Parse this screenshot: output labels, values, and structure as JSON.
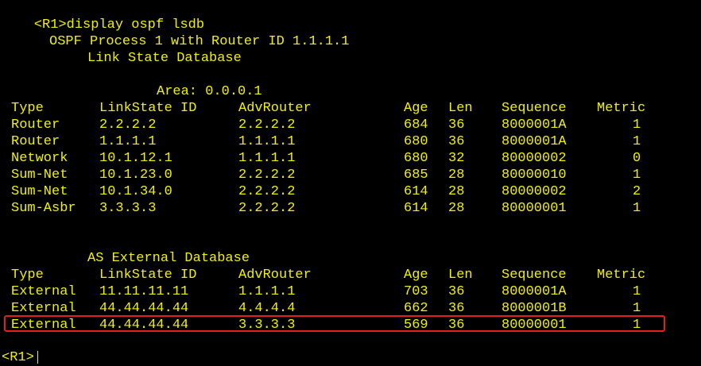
{
  "command_line": {
    "prompt": "<R1>",
    "command": "display ospf lsdb"
  },
  "header": {
    "process_line": "OSPF Process 1 with Router ID 1.1.1.1",
    "database_title": "Link State Database"
  },
  "area_section": {
    "area_label": "Area: 0.0.0.1",
    "columns": [
      "Type",
      "LinkState ID",
      "AdvRouter",
      "Age",
      "Len",
      "Sequence",
      "Metric"
    ],
    "rows": [
      {
        "type": "Router",
        "link_state_id": "2.2.2.2",
        "adv_router": "2.2.2.2",
        "age": "684",
        "len": "36",
        "sequence": "8000001A",
        "metric": "1"
      },
      {
        "type": "Router",
        "link_state_id": "1.1.1.1",
        "adv_router": "1.1.1.1",
        "age": "680",
        "len": "36",
        "sequence": "8000001A",
        "metric": "1"
      },
      {
        "type": "Network",
        "link_state_id": "10.1.12.1",
        "adv_router": "1.1.1.1",
        "age": "680",
        "len": "32",
        "sequence": "80000002",
        "metric": "0"
      },
      {
        "type": "Sum-Net",
        "link_state_id": "10.1.23.0",
        "adv_router": "2.2.2.2",
        "age": "685",
        "len": "28",
        "sequence": "80000010",
        "metric": "1"
      },
      {
        "type": "Sum-Net",
        "link_state_id": "10.1.34.0",
        "adv_router": "2.2.2.2",
        "age": "614",
        "len": "28",
        "sequence": "80000002",
        "metric": "2"
      },
      {
        "type": "Sum-Asbr",
        "link_state_id": "3.3.3.3",
        "adv_router": "2.2.2.2",
        "age": "614",
        "len": "28",
        "sequence": "80000001",
        "metric": "1"
      }
    ]
  },
  "external_section": {
    "title": "AS External Database",
    "columns": [
      "Type",
      "LinkState ID",
      "AdvRouter",
      "Age",
      "Len",
      "Sequence",
      "Metric"
    ],
    "rows": [
      {
        "type": "External",
        "link_state_id": "11.11.11.11",
        "adv_router": "1.1.1.1",
        "age": "703",
        "len": "36",
        "sequence": "8000001A",
        "metric": "1"
      },
      {
        "type": "External",
        "link_state_id": "44.44.44.44",
        "adv_router": "4.4.4.4",
        "age": "662",
        "len": "36",
        "sequence": "8000001B",
        "metric": "1"
      },
      {
        "type": "External",
        "link_state_id": "44.44.44.44",
        "adv_router": "3.3.3.3",
        "age": "569",
        "len": "36",
        "sequence": "80000001",
        "metric": "1"
      }
    ]
  },
  "final_prompt": "<R1>",
  "colors": {
    "background": "#000000",
    "text": "#f0f000",
    "highlight_border": "#e02020"
  }
}
